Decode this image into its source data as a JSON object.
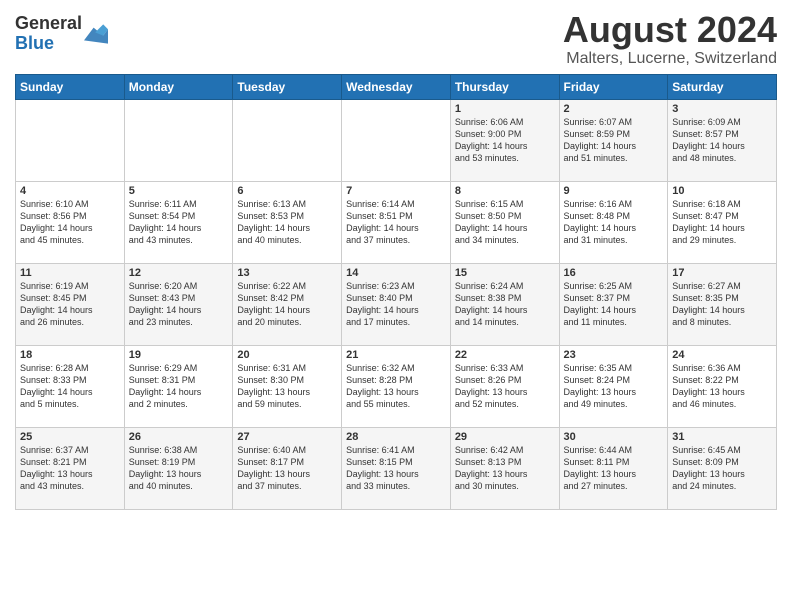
{
  "header": {
    "logo_line1": "General",
    "logo_line2": "Blue",
    "title": "August 2024",
    "subtitle": "Malters, Lucerne, Switzerland"
  },
  "days_of_week": [
    "Sunday",
    "Monday",
    "Tuesday",
    "Wednesday",
    "Thursday",
    "Friday",
    "Saturday"
  ],
  "weeks": [
    [
      {
        "day": "",
        "info": ""
      },
      {
        "day": "",
        "info": ""
      },
      {
        "day": "",
        "info": ""
      },
      {
        "day": "",
        "info": ""
      },
      {
        "day": "1",
        "info": "Sunrise: 6:06 AM\nSunset: 9:00 PM\nDaylight: 14 hours\nand 53 minutes."
      },
      {
        "day": "2",
        "info": "Sunrise: 6:07 AM\nSunset: 8:59 PM\nDaylight: 14 hours\nand 51 minutes."
      },
      {
        "day": "3",
        "info": "Sunrise: 6:09 AM\nSunset: 8:57 PM\nDaylight: 14 hours\nand 48 minutes."
      }
    ],
    [
      {
        "day": "4",
        "info": "Sunrise: 6:10 AM\nSunset: 8:56 PM\nDaylight: 14 hours\nand 45 minutes."
      },
      {
        "day": "5",
        "info": "Sunrise: 6:11 AM\nSunset: 8:54 PM\nDaylight: 14 hours\nand 43 minutes."
      },
      {
        "day": "6",
        "info": "Sunrise: 6:13 AM\nSunset: 8:53 PM\nDaylight: 14 hours\nand 40 minutes."
      },
      {
        "day": "7",
        "info": "Sunrise: 6:14 AM\nSunset: 8:51 PM\nDaylight: 14 hours\nand 37 minutes."
      },
      {
        "day": "8",
        "info": "Sunrise: 6:15 AM\nSunset: 8:50 PM\nDaylight: 14 hours\nand 34 minutes."
      },
      {
        "day": "9",
        "info": "Sunrise: 6:16 AM\nSunset: 8:48 PM\nDaylight: 14 hours\nand 31 minutes."
      },
      {
        "day": "10",
        "info": "Sunrise: 6:18 AM\nSunset: 8:47 PM\nDaylight: 14 hours\nand 29 minutes."
      }
    ],
    [
      {
        "day": "11",
        "info": "Sunrise: 6:19 AM\nSunset: 8:45 PM\nDaylight: 14 hours\nand 26 minutes."
      },
      {
        "day": "12",
        "info": "Sunrise: 6:20 AM\nSunset: 8:43 PM\nDaylight: 14 hours\nand 23 minutes."
      },
      {
        "day": "13",
        "info": "Sunrise: 6:22 AM\nSunset: 8:42 PM\nDaylight: 14 hours\nand 20 minutes."
      },
      {
        "day": "14",
        "info": "Sunrise: 6:23 AM\nSunset: 8:40 PM\nDaylight: 14 hours\nand 17 minutes."
      },
      {
        "day": "15",
        "info": "Sunrise: 6:24 AM\nSunset: 8:38 PM\nDaylight: 14 hours\nand 14 minutes."
      },
      {
        "day": "16",
        "info": "Sunrise: 6:25 AM\nSunset: 8:37 PM\nDaylight: 14 hours\nand 11 minutes."
      },
      {
        "day": "17",
        "info": "Sunrise: 6:27 AM\nSunset: 8:35 PM\nDaylight: 14 hours\nand 8 minutes."
      }
    ],
    [
      {
        "day": "18",
        "info": "Sunrise: 6:28 AM\nSunset: 8:33 PM\nDaylight: 14 hours\nand 5 minutes."
      },
      {
        "day": "19",
        "info": "Sunrise: 6:29 AM\nSunset: 8:31 PM\nDaylight: 14 hours\nand 2 minutes."
      },
      {
        "day": "20",
        "info": "Sunrise: 6:31 AM\nSunset: 8:30 PM\nDaylight: 13 hours\nand 59 minutes."
      },
      {
        "day": "21",
        "info": "Sunrise: 6:32 AM\nSunset: 8:28 PM\nDaylight: 13 hours\nand 55 minutes."
      },
      {
        "day": "22",
        "info": "Sunrise: 6:33 AM\nSunset: 8:26 PM\nDaylight: 13 hours\nand 52 minutes."
      },
      {
        "day": "23",
        "info": "Sunrise: 6:35 AM\nSunset: 8:24 PM\nDaylight: 13 hours\nand 49 minutes."
      },
      {
        "day": "24",
        "info": "Sunrise: 6:36 AM\nSunset: 8:22 PM\nDaylight: 13 hours\nand 46 minutes."
      }
    ],
    [
      {
        "day": "25",
        "info": "Sunrise: 6:37 AM\nSunset: 8:21 PM\nDaylight: 13 hours\nand 43 minutes."
      },
      {
        "day": "26",
        "info": "Sunrise: 6:38 AM\nSunset: 8:19 PM\nDaylight: 13 hours\nand 40 minutes."
      },
      {
        "day": "27",
        "info": "Sunrise: 6:40 AM\nSunset: 8:17 PM\nDaylight: 13 hours\nand 37 minutes."
      },
      {
        "day": "28",
        "info": "Sunrise: 6:41 AM\nSunset: 8:15 PM\nDaylight: 13 hours\nand 33 minutes."
      },
      {
        "day": "29",
        "info": "Sunrise: 6:42 AM\nSunset: 8:13 PM\nDaylight: 13 hours\nand 30 minutes."
      },
      {
        "day": "30",
        "info": "Sunrise: 6:44 AM\nSunset: 8:11 PM\nDaylight: 13 hours\nand 27 minutes."
      },
      {
        "day": "31",
        "info": "Sunrise: 6:45 AM\nSunset: 8:09 PM\nDaylight: 13 hours\nand 24 minutes."
      }
    ]
  ]
}
